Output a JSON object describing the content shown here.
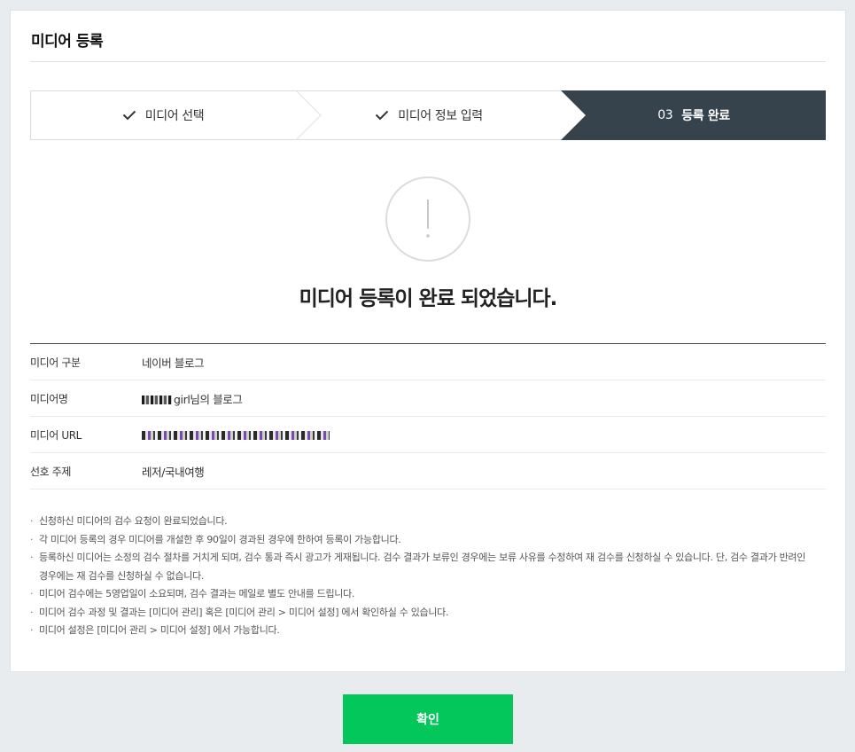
{
  "page": {
    "title": "미디어 등록",
    "headline": "미디어 등록이 완료 되었습니다.",
    "confirm_label": "확인"
  },
  "steps": [
    {
      "label": "미디어 선택",
      "state": "done",
      "icon": "check-icon"
    },
    {
      "label": "미디어 정보 입력",
      "state": "done",
      "icon": "check-icon"
    },
    {
      "number": "03",
      "label": "등록 완료",
      "state": "current"
    }
  ],
  "status_icon": "exclamation-circle-icon",
  "info": [
    {
      "key": "미디어 구분",
      "value": "네이버 블로그"
    },
    {
      "key": "미디어명",
      "value": "girl님의 블로그"
    },
    {
      "key": "미디어 URL",
      "value": ""
    },
    {
      "key": "선호 주제",
      "value": "레저/국내여행"
    }
  ],
  "notes": [
    "신청하신 미디어의 검수 요청이 완료되었습니다.",
    "각 미디어 등록의 경우 미디어를 개설한 후 90일이 경과된 경우에 한하여 등록이 가능합니다.",
    "등록하신 미디어는 소정의 검수 절차를 거치게 되며, 검수 통과 즉시 광고가 게재됩니다. 검수 결과가 보류인 경우에는 보류 사유를 수정하여 재 검수를 신청하실 수 있습니다. 단, 검수 결과가 반려인 경우에는 재 검수를 신청하실 수 없습니다.",
    "미디어 검수에는 5영업일이 소요되며, 검수 결과는 메일로 별도 안내를 드립니다.",
    "미디어 검수 과정 및 결과는 [미디어 관리] 혹은 [미디어 관리 > 미디어 설정] 에서 확인하실 수 있습니다.",
    "미디어 설정은 [미디어 관리 > 미디어 설정] 에서 가능합니다."
  ],
  "colors": {
    "current_step_bg": "#37434c",
    "confirm_bg": "#03c75a",
    "page_bg": "#e9ecef"
  }
}
